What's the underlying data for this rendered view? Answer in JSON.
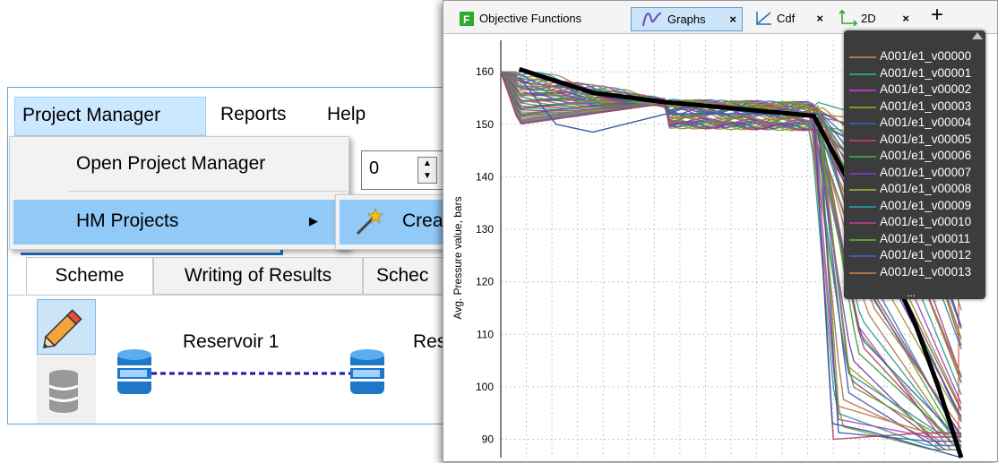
{
  "menubar": {
    "items": [
      "Project Manager",
      "Reports",
      "Help"
    ]
  },
  "dropdown": {
    "open_label": "Open Project Manager",
    "hm_label": "HM Projects",
    "submenu_label": "Crea"
  },
  "toolbar": {
    "number_value": "0"
  },
  "tabs": [
    "Scheme",
    "Writing of Results",
    "Schec"
  ],
  "scheme": {
    "reservoir1": "Reservoir 1",
    "reservoir2": "Res"
  },
  "graph_tabs": [
    {
      "label": "Objective Functions",
      "icon": "objective-f-icon",
      "closable": false
    },
    {
      "label": "Graphs",
      "icon": "graphs-curve-icon",
      "closable": true,
      "active": true
    },
    {
      "label": "Cdf",
      "icon": "cdf-icon",
      "closable": true
    },
    {
      "label": "2D",
      "icon": "axes-2d-icon",
      "closable": true
    }
  ],
  "add_tab_symbol": "+",
  "close_symbol": "×",
  "chart_data": {
    "type": "line",
    "ylabel": "Avg. Pressure value, bars",
    "xlabel": "",
    "ylim": [
      86.5,
      166
    ],
    "yticks": [
      90,
      100,
      110,
      120,
      130,
      140,
      150,
      160
    ],
    "grid": true,
    "legend_position": "top-right",
    "legend_more": "...",
    "series": [
      {
        "name": "A001/e1_v00000",
        "color": "#b07a4a"
      },
      {
        "name": "A001/e1_v00001",
        "color": "#2a9d8f"
      },
      {
        "name": "A001/e1_v00002",
        "color": "#b040b8"
      },
      {
        "name": "A001/e1_v00003",
        "color": "#7a9a2a"
      },
      {
        "name": "A001/e1_v00004",
        "color": "#3a5aa8"
      },
      {
        "name": "A001/e1_v00005",
        "color": "#b04060"
      },
      {
        "name": "A001/e1_v00006",
        "color": "#3a9a3a"
      },
      {
        "name": "A001/e1_v00007",
        "color": "#7040b0"
      },
      {
        "name": "A001/e1_v00008",
        "color": "#9a9a30"
      },
      {
        "name": "A001/e1_v00009",
        "color": "#2a8aa0"
      },
      {
        "name": "A001/e1_v00010",
        "color": "#a04080"
      },
      {
        "name": "A001/e1_v00011",
        "color": "#5aa02a"
      },
      {
        "name": "A001/e1_v00012",
        "color": "#4a58b0"
      },
      {
        "name": "A001/e1_v00013",
        "color": "#b07040"
      }
    ]
  }
}
